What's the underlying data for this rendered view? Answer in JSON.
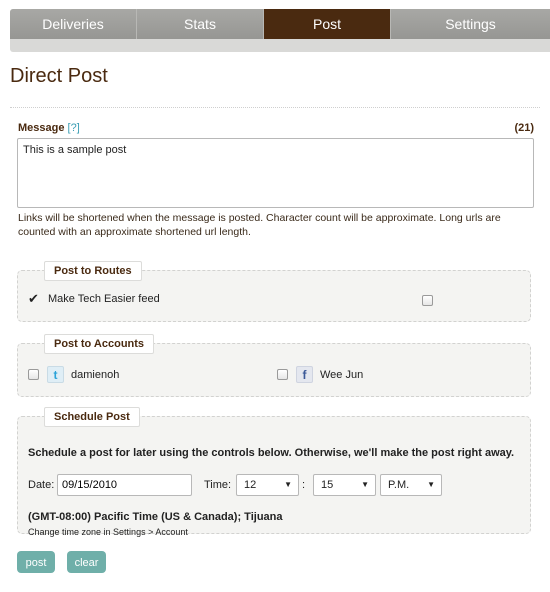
{
  "tabs": [
    {
      "label": "Deliveries",
      "active": false
    },
    {
      "label": "Stats",
      "active": false
    },
    {
      "label": "Post",
      "active": true
    },
    {
      "label": "Settings",
      "active": false
    }
  ],
  "page": {
    "title": "Direct Post"
  },
  "message": {
    "label": "Message",
    "help_link": "[?]",
    "char_count": "(21)",
    "value": "This is a sample post",
    "note": "Links will be shortened when the message is posted. Character count will be approximate. Long urls are counted with an approximate shortened url length."
  },
  "routes": {
    "legend": "Post to Routes",
    "items": [
      {
        "label": "Make Tech Easier feed",
        "checked": true
      },
      {
        "label": "",
        "checked": false
      }
    ]
  },
  "accounts": {
    "legend": "Post to Accounts",
    "items": [
      {
        "label": "damienoh",
        "service": "twitter-icon",
        "icon_glyph": "t",
        "checked": false
      },
      {
        "label": "Wee Jun",
        "service": "facebook-icon",
        "icon_glyph": "f",
        "checked": false
      }
    ]
  },
  "schedule": {
    "legend": "Schedule Post",
    "description": "Schedule a post for later using the controls below. Otherwise, we'll make the post right away.",
    "date_label": "Date:",
    "date_value": "09/15/2010",
    "time_label": "Time:",
    "hour": "12",
    "minute": "15",
    "separator": ":",
    "ampm": "P.M.",
    "timezone": "(GMT-08:00) Pacific Time (US & Canada); Tijuana",
    "timezone_hint": "Change time zone in Settings > Account"
  },
  "buttons": {
    "post": "post",
    "clear": "clear"
  },
  "colors": {
    "active_tab": "#4a2a10",
    "accent_button": "#6fafa9",
    "link": "#3c9fb4"
  }
}
